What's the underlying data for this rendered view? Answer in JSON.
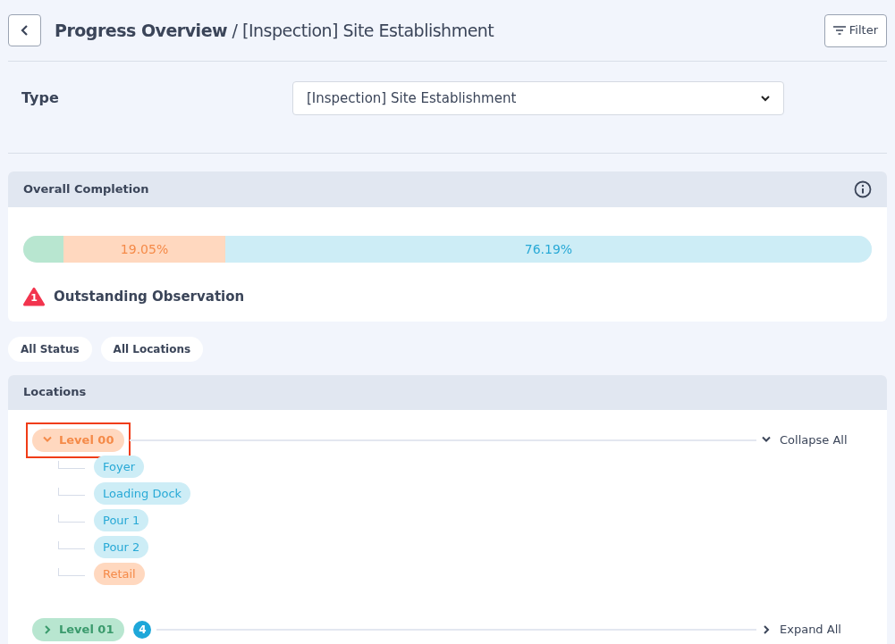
{
  "header": {
    "title": "**Progress Overview** / [Inspection] Site Establishment",
    "filter_button": "Filter"
  },
  "type_field": {
    "label": "Type",
    "value": "[Inspection] Site Establishment"
  },
  "overall_completion": {
    "title": "Overall Completion",
    "segments": [
      {
        "color": "#b8e6d0",
        "level": 0.0476
      },
      {
        "color": "#ffd8bf",
        "level": 0.1905,
        "label": "19.05%"
      },
      {
        "color": "#cdedf6",
        "level": 0.7619,
        "label": "76.19%"
      }
    ],
    "observations": {
      "count": "1",
      "label": "Outstanding Observation"
    }
  },
  "filters": [
    "All Status",
    "All Locations"
  ],
  "locations": {
    "title": "Locations",
    "levels": [
      {
        "name": "Level 00",
        "color": "#ffd8bf",
        "expanded": true,
        "highlighted": true,
        "action": "Collapse All",
        "children": [
          {
            "name": "Foyer",
            "color": "#cdedf6"
          },
          {
            "name": "Loading Dock",
            "color": "#cdedf6"
          },
          {
            "name": "Pour 1",
            "color": "#cdedf6"
          },
          {
            "name": "Pour 2",
            "color": "#cdedf6"
          },
          {
            "name": "Retail",
            "color": "#ffd8bf"
          }
        ]
      },
      {
        "name": "Level 01",
        "color": "#b8e6d0",
        "expanded": false,
        "highlighted": false,
        "count": "4",
        "action": "Expand All"
      }
    ]
  }
}
